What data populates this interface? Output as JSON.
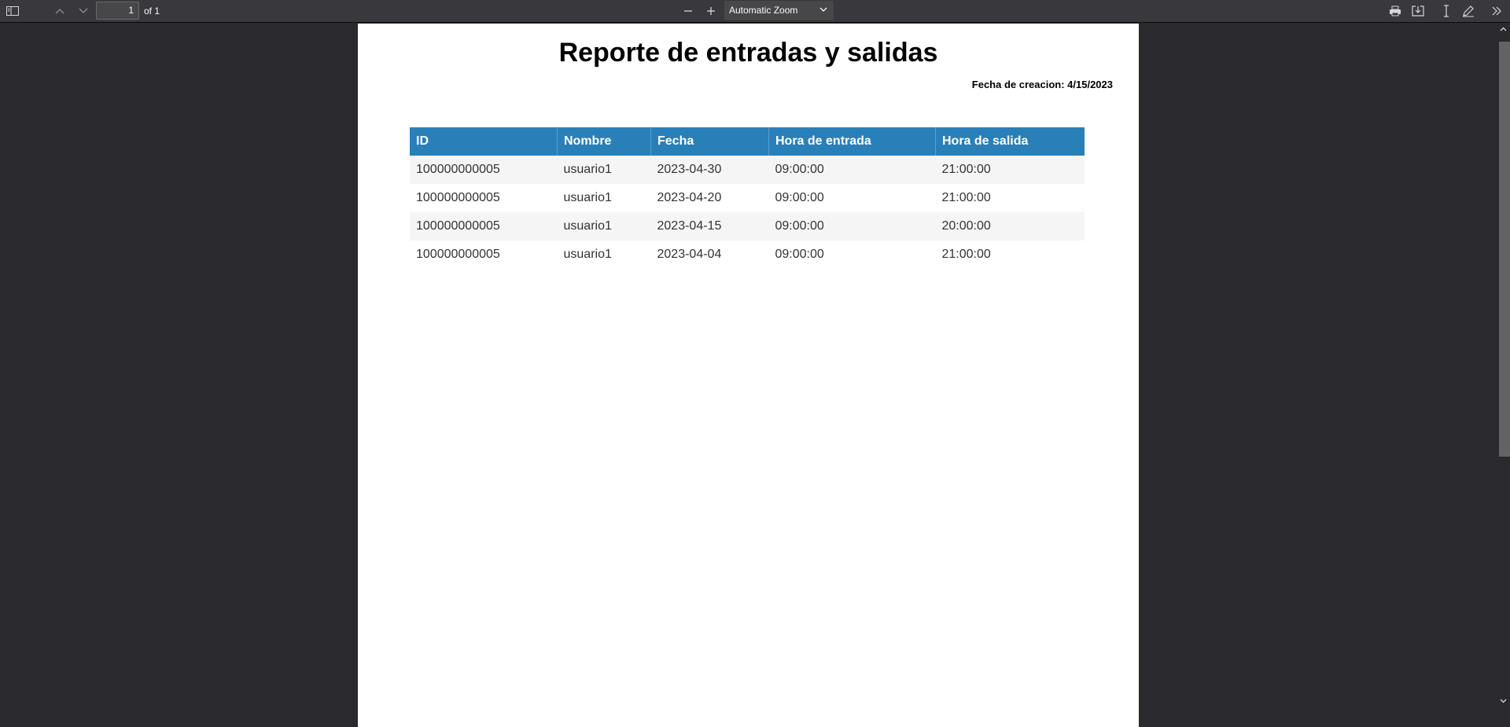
{
  "toolbar": {
    "sidebar_icon": "sidebar-toggle-icon",
    "page_number": "1",
    "page_of": "of 1",
    "zoom_value": "Automatic Zoom",
    "icons": [
      "chevron-up-icon",
      "chevron-down-icon",
      "zoom-out-icon",
      "zoom-in-icon",
      "print-icon",
      "download-icon",
      "text-cursor-icon",
      "pen-icon",
      "double-chevron-icon"
    ]
  },
  "document": {
    "title": "Reporte de entradas y salidas",
    "created": "Fecha de creacion: 4/15/2023",
    "columns": [
      "ID",
      "Nombre",
      "Fecha",
      "Hora de entrada",
      "Hora de salida"
    ],
    "rows": [
      [
        "100000000005",
        "usuario1",
        "2023-04-30",
        "09:00:00",
        "21:00:00"
      ],
      [
        "100000000005",
        "usuario1",
        "2023-04-20",
        "09:00:00",
        "21:00:00"
      ],
      [
        "100000000005",
        "usuario1",
        "2023-04-15",
        "09:00:00",
        "20:00:00"
      ],
      [
        "100000000005",
        "usuario1",
        "2023-04-04",
        "09:00:00",
        "21:00:00"
      ]
    ]
  },
  "colors": {
    "header_bg": "#2980b9",
    "viewer_bg": "#2a2a2e",
    "toolbar_bg": "#38383d"
  }
}
